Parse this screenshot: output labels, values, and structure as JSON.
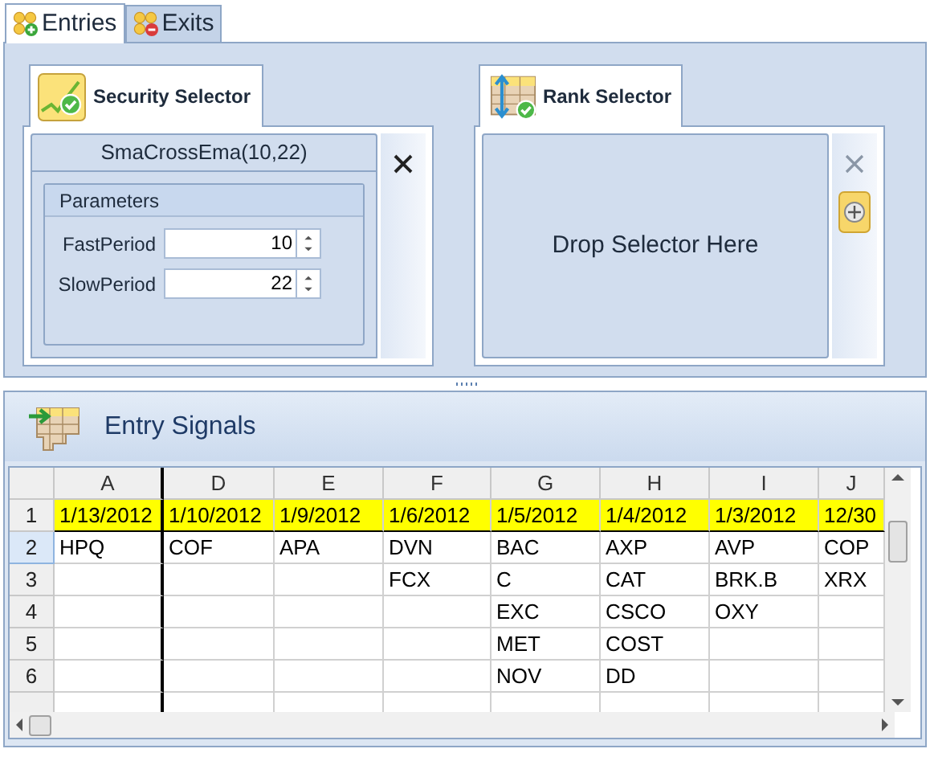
{
  "tabs": [
    {
      "label": "Entries",
      "kind": "add",
      "selected": true
    },
    {
      "label": "Exits",
      "kind": "remove",
      "selected": false
    }
  ],
  "security_selector": {
    "title": "Security Selector",
    "selector_name": "SmaCrossEma(10,22)",
    "parameters_title": "Parameters",
    "parameters": [
      {
        "label": "FastPeriod",
        "value": "10"
      },
      {
        "label": "SlowPeriod",
        "value": "22"
      }
    ]
  },
  "rank_selector": {
    "title": "Rank Selector",
    "placeholder": "Drop Selector Here",
    "close_disabled": true
  },
  "signals": {
    "title": "Entry Signals",
    "columns": [
      {
        "label": "A",
        "frozen": true
      },
      {
        "label": "D",
        "frozen": false
      },
      {
        "label": "E",
        "frozen": false
      },
      {
        "label": "F",
        "frozen": false
      },
      {
        "label": "G",
        "frozen": false
      },
      {
        "label": "H",
        "frozen": false
      },
      {
        "label": "I",
        "frozen": false
      },
      {
        "label": "J",
        "frozen": false
      }
    ],
    "rows": [
      {
        "header": "1",
        "highlight": true,
        "selected": false,
        "cells": [
          "1/13/2012",
          "1/10/2012",
          "1/9/2012",
          "1/6/2012",
          "1/5/2012",
          "1/4/2012",
          "1/3/2012",
          "12/30"
        ]
      },
      {
        "header": "2",
        "highlight": false,
        "selected": true,
        "cells": [
          "HPQ",
          "COF",
          "APA",
          "DVN",
          "BAC",
          "AXP",
          "AVP",
          "COP"
        ]
      },
      {
        "header": "3",
        "highlight": false,
        "selected": false,
        "cells": [
          "",
          "",
          "",
          "FCX",
          "C",
          "CAT",
          "BRK.B",
          "XRX"
        ]
      },
      {
        "header": "4",
        "highlight": false,
        "selected": false,
        "cells": [
          "",
          "",
          "",
          "",
          "EXC",
          "CSCO",
          "OXY",
          ""
        ]
      },
      {
        "header": "5",
        "highlight": false,
        "selected": false,
        "cells": [
          "",
          "",
          "",
          "",
          "MET",
          "COST",
          "",
          ""
        ]
      },
      {
        "header": "6",
        "highlight": false,
        "selected": false,
        "cells": [
          "",
          "",
          "",
          "",
          "NOV",
          "DD",
          "",
          ""
        ]
      }
    ]
  }
}
